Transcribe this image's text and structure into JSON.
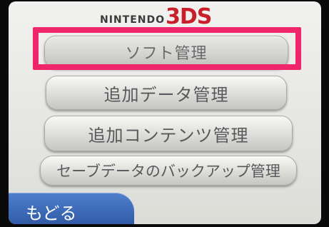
{
  "header": {
    "brand_text": "NINTENDO",
    "model_text": "3DS"
  },
  "menu": {
    "items": [
      {
        "label": "ソフト管理",
        "selected": true
      },
      {
        "label": "追加データ管理"
      },
      {
        "label": "追加コンテンツ管理"
      },
      {
        "label": "セーブデータのバックアップ管理"
      }
    ]
  },
  "footer": {
    "back_label": "もどる"
  },
  "colors": {
    "highlight": "#f0256b",
    "back_button": "#3a66b2",
    "logo_red": "#c91f2a"
  }
}
